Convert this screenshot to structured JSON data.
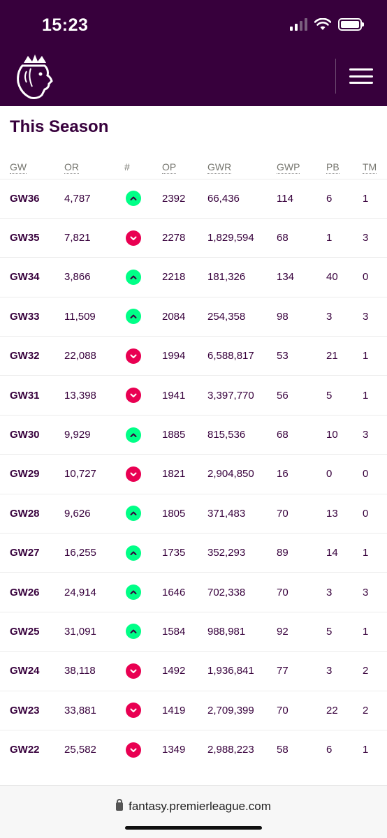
{
  "status_bar": {
    "time": "15:23"
  },
  "page": {
    "title": "This Season"
  },
  "table": {
    "columns": [
      "GW",
      "OR",
      "#",
      "OP",
      "GWR",
      "GWP",
      "PB",
      "TM"
    ],
    "rows": [
      {
        "gw": "GW36",
        "or": "4,787",
        "dir": "up",
        "op": "2392",
        "gwr": "66,436",
        "gwp": "114",
        "pb": "6",
        "tm": "1"
      },
      {
        "gw": "GW35",
        "or": "7,821",
        "dir": "down",
        "op": "2278",
        "gwr": "1,829,594",
        "gwp": "68",
        "pb": "1",
        "tm": "3"
      },
      {
        "gw": "GW34",
        "or": "3,866",
        "dir": "up",
        "op": "2218",
        "gwr": "181,326",
        "gwp": "134",
        "pb": "40",
        "tm": "0"
      },
      {
        "gw": "GW33",
        "or": "11,509",
        "dir": "up",
        "op": "2084",
        "gwr": "254,358",
        "gwp": "98",
        "pb": "3",
        "tm": "3"
      },
      {
        "gw": "GW32",
        "or": "22,088",
        "dir": "down",
        "op": "1994",
        "gwr": "6,588,817",
        "gwp": "53",
        "pb": "21",
        "tm": "1"
      },
      {
        "gw": "GW31",
        "or": "13,398",
        "dir": "down",
        "op": "1941",
        "gwr": "3,397,770",
        "gwp": "56",
        "pb": "5",
        "tm": "1"
      },
      {
        "gw": "GW30",
        "or": "9,929",
        "dir": "up",
        "op": "1885",
        "gwr": "815,536",
        "gwp": "68",
        "pb": "10",
        "tm": "3"
      },
      {
        "gw": "GW29",
        "or": "10,727",
        "dir": "down",
        "op": "1821",
        "gwr": "2,904,850",
        "gwp": "16",
        "pb": "0",
        "tm": "0"
      },
      {
        "gw": "GW28",
        "or": "9,626",
        "dir": "up",
        "op": "1805",
        "gwr": "371,483",
        "gwp": "70",
        "pb": "13",
        "tm": "0"
      },
      {
        "gw": "GW27",
        "or": "16,255",
        "dir": "up",
        "op": "1735",
        "gwr": "352,293",
        "gwp": "89",
        "pb": "14",
        "tm": "1"
      },
      {
        "gw": "GW26",
        "or": "24,914",
        "dir": "up",
        "op": "1646",
        "gwr": "702,338",
        "gwp": "70",
        "pb": "3",
        "tm": "3"
      },
      {
        "gw": "GW25",
        "or": "31,091",
        "dir": "up",
        "op": "1584",
        "gwr": "988,981",
        "gwp": "92",
        "pb": "5",
        "tm": "1"
      },
      {
        "gw": "GW24",
        "or": "38,118",
        "dir": "down",
        "op": "1492",
        "gwr": "1,936,841",
        "gwp": "77",
        "pb": "3",
        "tm": "2"
      },
      {
        "gw": "GW23",
        "or": "33,881",
        "dir": "down",
        "op": "1419",
        "gwr": "2,709,399",
        "gwp": "70",
        "pb": "22",
        "tm": "2"
      },
      {
        "gw": "GW22",
        "or": "25,582",
        "dir": "down",
        "op": "1349",
        "gwr": "2,988,223",
        "gwp": "58",
        "pb": "6",
        "tm": "1"
      }
    ]
  },
  "browser": {
    "url": "fantasy.premierleague.com"
  },
  "colors": {
    "brand": "#37003c",
    "up": "#00ff87",
    "down": "#e90052"
  }
}
